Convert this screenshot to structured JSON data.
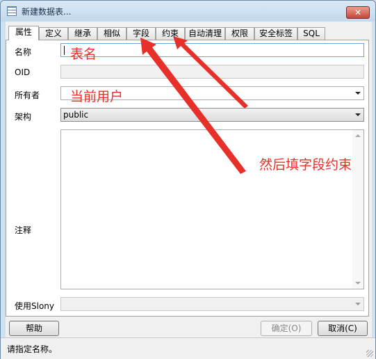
{
  "window": {
    "title": "新建数据表..."
  },
  "tabs": [
    {
      "label": "属性"
    },
    {
      "label": "定义"
    },
    {
      "label": "继承"
    },
    {
      "label": "相似"
    },
    {
      "label": "字段"
    },
    {
      "label": "约束"
    },
    {
      "label": "自动清理"
    },
    {
      "label": "权限"
    },
    {
      "label": "安全标签"
    },
    {
      "label": "SQL"
    }
  ],
  "form": {
    "name_label": "名称",
    "name_value": "",
    "oid_label": "OID",
    "oid_value": "",
    "owner_label": "所有者",
    "owner_value": "",
    "schema_label": "架构",
    "schema_value": "public",
    "comment_label": "注释",
    "comment_value": "",
    "slony_label": "使用Slony",
    "slony_value": ""
  },
  "buttons": {
    "help": "帮助",
    "ok": "确定(O)",
    "cancel": "取消(C)"
  },
  "status": {
    "text": "请指定名称。"
  },
  "annotations": {
    "table_name": "表名",
    "current_user": "当前用户",
    "then_fill": "然后填字段约束",
    "color": "#e8302a"
  }
}
